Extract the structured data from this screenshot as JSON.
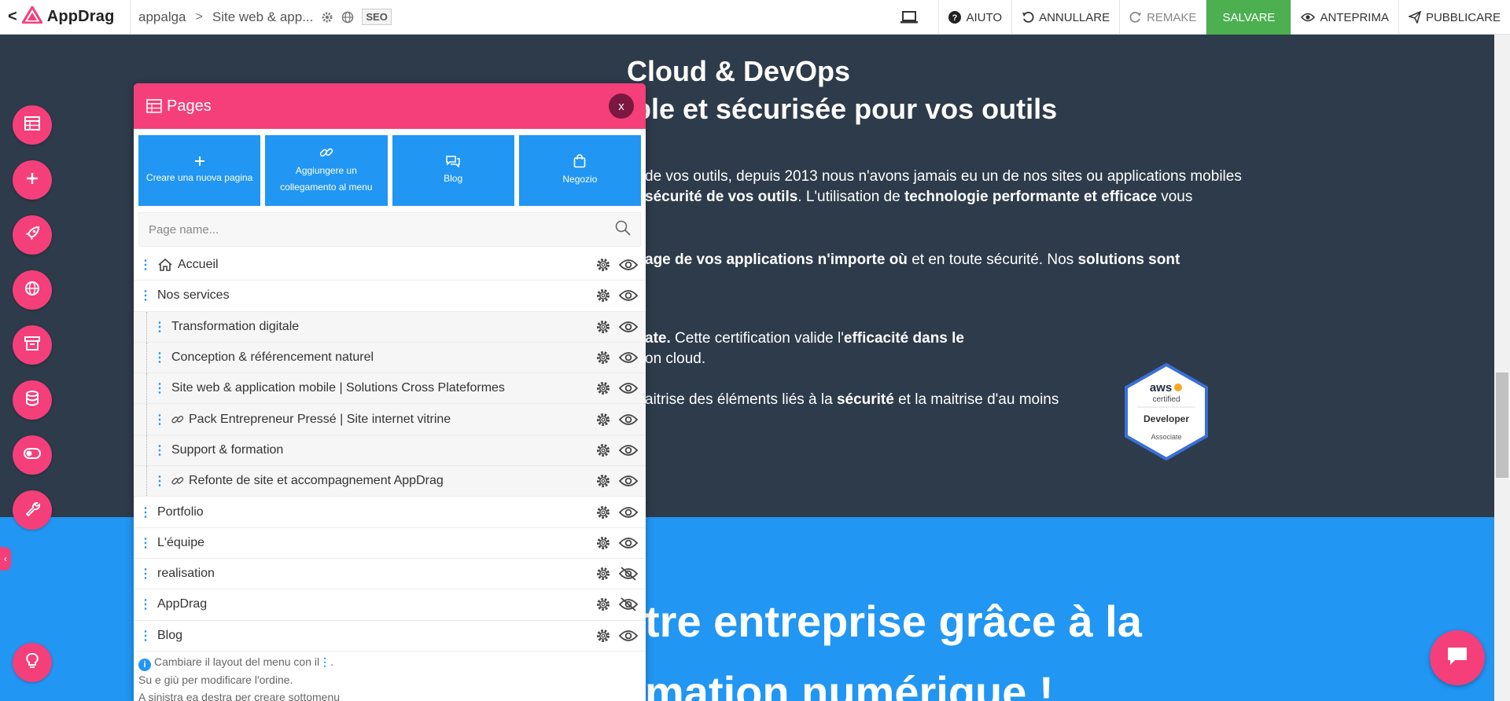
{
  "app": {
    "brand": "AppDrag",
    "back_glyph": "<",
    "breadcrumb": [
      "appalga",
      "Site web & app..."
    ],
    "breadcrumb_sep": ">",
    "seo_label": "SEO"
  },
  "toolbar": {
    "help_label": "AIUTO",
    "undo_label": "ANNULLARE",
    "redo_label": "REMAKE",
    "save_label": "SALVARE",
    "preview_label": "ANTEPRIMA",
    "publish_label": "PUBBLICARE"
  },
  "pages_panel": {
    "title": "Pages",
    "close_label": "x",
    "actions": [
      {
        "label": "Creare una nuova pagina",
        "icon": "plus-icon"
      },
      {
        "label": "Aggiungere un collegamento al menu",
        "icon": "link-icon"
      },
      {
        "label": "Blog",
        "icon": "chat-icon"
      },
      {
        "label": "Negozio",
        "icon": "shopping-bag-icon"
      }
    ],
    "search_placeholder": "Page name...",
    "pages": [
      {
        "label": "Accueil",
        "child": false,
        "icon": "home-icon",
        "visible": true
      },
      {
        "label": "Nos services",
        "child": false,
        "icon": null,
        "visible": true
      },
      {
        "label": "Transformation digitale",
        "child": true,
        "icon": null,
        "visible": true
      },
      {
        "label": "Conception & référencement naturel",
        "child": true,
        "icon": null,
        "visible": true
      },
      {
        "label": "Site web & application mobile | Solutions Cross Plateformes",
        "child": true,
        "icon": null,
        "visible": true,
        "active": true
      },
      {
        "label": "Pack Entrepreneur Pressé | Site internet vitrine",
        "child": true,
        "icon": "link-icon",
        "visible": true
      },
      {
        "label": "Support & formation",
        "child": true,
        "icon": null,
        "visible": true
      },
      {
        "label": "Refonte de site et accompagnement AppDrag",
        "child": true,
        "icon": "link-icon",
        "visible": true
      },
      {
        "label": "Portfolio",
        "child": false,
        "icon": null,
        "visible": true
      },
      {
        "label": "L'équipe",
        "child": false,
        "icon": null,
        "visible": true
      },
      {
        "label": "realisation",
        "child": false,
        "icon": null,
        "visible": false
      },
      {
        "label": "AppDrag",
        "child": false,
        "icon": null,
        "visible": false
      },
      {
        "label": "Blog",
        "child": false,
        "icon": null,
        "visible": true
      }
    ],
    "help": {
      "line1": "Cambiare il layout del menu con il",
      "line1_handle": "⋮",
      "line1_end": ".",
      "line2": "Su e giù per modificare l'ordine.",
      "line3": "A sinistra ea destra per creare sottomenu"
    }
  },
  "page_content": {
    "heading1": "Cloud & DevOps",
    "heading2": "ble et sécurisée pour vos outils",
    "p1a": "de vos outils, depuis 2013 nous n'avons jamais eu un de nos sites ou applications mobiles",
    "p1b_bold1": "sécurité de vos outils",
    "p1b_mid": ". L'utilisation de ",
    "p1b_bold2": "technologie performante et efficace",
    "p1b_end": " vous",
    "p2_bold1": "age de vos applications n'importe où",
    "p2_mid": " et en toute sécurité. Nos ",
    "p2_bold2": "solutions sont",
    "p3_bold1": "ate.",
    "p3_mid": " Cette certification valide l'",
    "p3_bold2": "efficacité dans le",
    "p3b": "on cloud.",
    "p4a": "aitrise des éléments liés à la ",
    "p4_bold": "sécurité",
    "p4b": " et la maitrise d'au moins",
    "blue_line1": "tre entreprise grâce à la",
    "blue_line2": "mation numérique !",
    "aws_text": "aws",
    "aws_certified": "certified",
    "aws_role": "Developer",
    "aws_level": "Associate"
  },
  "colors": {
    "accent": "#f43f7a",
    "primary_blue": "#2196f3",
    "save_green": "#4caf50",
    "dark_section": "#2d3b4a"
  }
}
